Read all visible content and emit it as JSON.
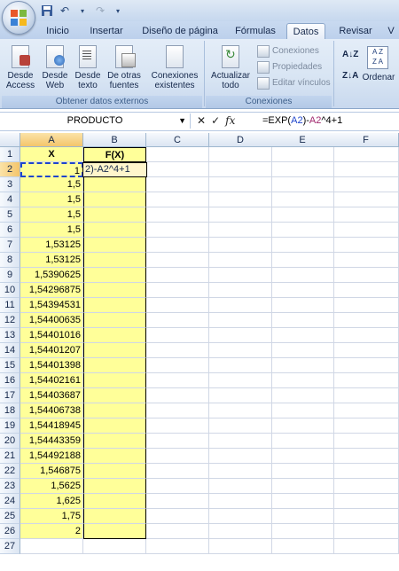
{
  "ribbon_tabs": [
    "Inicio",
    "Insertar",
    "Diseño de página",
    "Fórmulas",
    "Datos",
    "Revisar",
    "V"
  ],
  "active_tab": "Datos",
  "groups": {
    "external": {
      "label": "Obtener datos externos",
      "buttons": [
        "Desde Access",
        "Desde Web",
        "Desde texto",
        "De otras fuentes",
        "Conexiones existentes"
      ]
    },
    "connections": {
      "label": "Conexiones",
      "refresh": "Actualizar todo",
      "items": [
        "Conexiones",
        "Propiedades",
        "Editar vínculos"
      ]
    },
    "sort": {
      "az": "A↓Z",
      "za": "Z↓A",
      "label": "Ordenar"
    }
  },
  "formula_bar": {
    "name_box": "PRODUCTO",
    "formula_prefix": "=EXP(",
    "ref_a": "A2",
    "formula_mid": ")-",
    "ref_b": "A2",
    "formula_suffix": "^4+1"
  },
  "columns": [
    "A",
    "B",
    "C",
    "D",
    "E",
    "F"
  ],
  "header_row": {
    "a": "X",
    "b": "F(X)"
  },
  "editing_text": "2)-A2^4+1",
  "x_values": [
    "1",
    "1,5",
    "1,5",
    "1,5",
    "1,5",
    "1,53125",
    "1,53125",
    "1,5390625",
    "1,54296875",
    "1,54394531",
    "1,54400635",
    "1,54401016",
    "1,54401207",
    "1,54401398",
    "1,54402161",
    "1,54403687",
    "1,54406738",
    "1,54418945",
    "1,54443359",
    "1,54492188",
    "1,546875",
    "1,5625",
    "1,625",
    "1,75",
    "2"
  ],
  "row_numbers": [
    "1",
    "2",
    "3",
    "4",
    "5",
    "6",
    "7",
    "8",
    "9",
    "10",
    "11",
    "12",
    "13",
    "14",
    "15",
    "16",
    "17",
    "18",
    "19",
    "20",
    "21",
    "22",
    "23",
    "24",
    "25",
    "26",
    "27"
  ],
  "colors": {
    "highlight": "#ffff99",
    "ref_a": "#1f45cc",
    "ref_b": "#a0266d"
  }
}
